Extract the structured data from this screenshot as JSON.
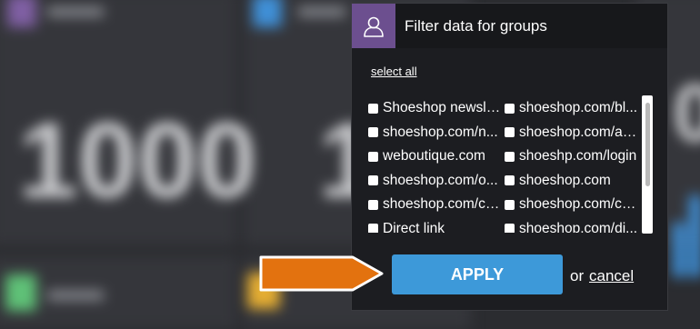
{
  "popup": {
    "title": "Filter data for groups",
    "header_icon": "user-icon",
    "select_all": "select all",
    "items": [
      {
        "label": "Shoeshop newsle...",
        "checked": false
      },
      {
        "label": "shoeshop.com/bl...",
        "checked": false
      },
      {
        "label": "shoeshop.com/n...",
        "checked": false
      },
      {
        "label": "shoeshop.com/ac...",
        "checked": false
      },
      {
        "label": "weboutique.com",
        "checked": false
      },
      {
        "label": "shoeshp.com/login",
        "checked": false
      },
      {
        "label": "shoeshop.com/o...",
        "checked": false
      },
      {
        "label": "shoeshop.com",
        "checked": false
      },
      {
        "label": "shoeshop.com/ch...",
        "checked": false
      },
      {
        "label": "shoeshop.com/ca...",
        "checked": false
      },
      {
        "label": "Direct link",
        "checked": false
      },
      {
        "label": "shoeshop.com/di...",
        "checked": false
      }
    ],
    "apply_label": "APPLY",
    "or_text": "or",
    "cancel_label": "cancel"
  },
  "background": {
    "tile_values": [
      "1000",
      "1",
      "0"
    ]
  },
  "colors": {
    "header_icon_bg": "#6c4f8f",
    "apply_button": "#3d99d9",
    "pointer_arrow": "#e3720f"
  }
}
